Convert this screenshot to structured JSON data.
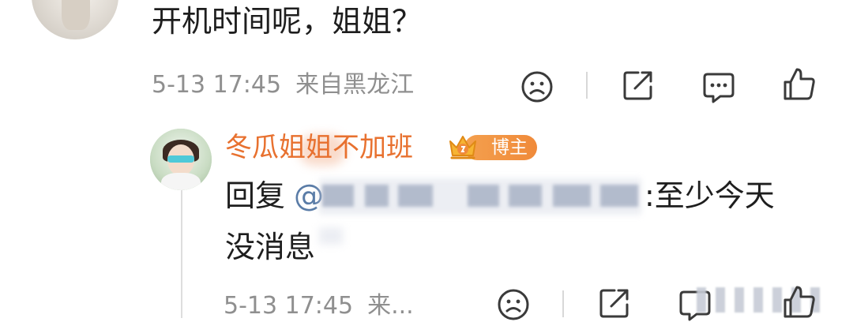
{
  "top_comment": {
    "text": "开机时间呢，姐姐？",
    "date": "5-13 17:45",
    "location": "来自黑龙江"
  },
  "reply": {
    "author": "冬瓜姐姐不加班",
    "badge_label": "博主",
    "reply_prefix": "回复",
    "mention_at": "@",
    "text_line1_tail": ":至少今天",
    "text_line2": "没消息",
    "date": "5-13 17:45",
    "location_truncated": "来..."
  },
  "icons": {
    "dislike": "sad-face-icon",
    "share": "share-icon",
    "comment": "comment-icon",
    "like": "thumbs-up-icon"
  },
  "colors": {
    "author": "#e8712f",
    "mention": "#5a7ca7",
    "meta": "#8f8f8f",
    "badge": "#f08a3a"
  }
}
